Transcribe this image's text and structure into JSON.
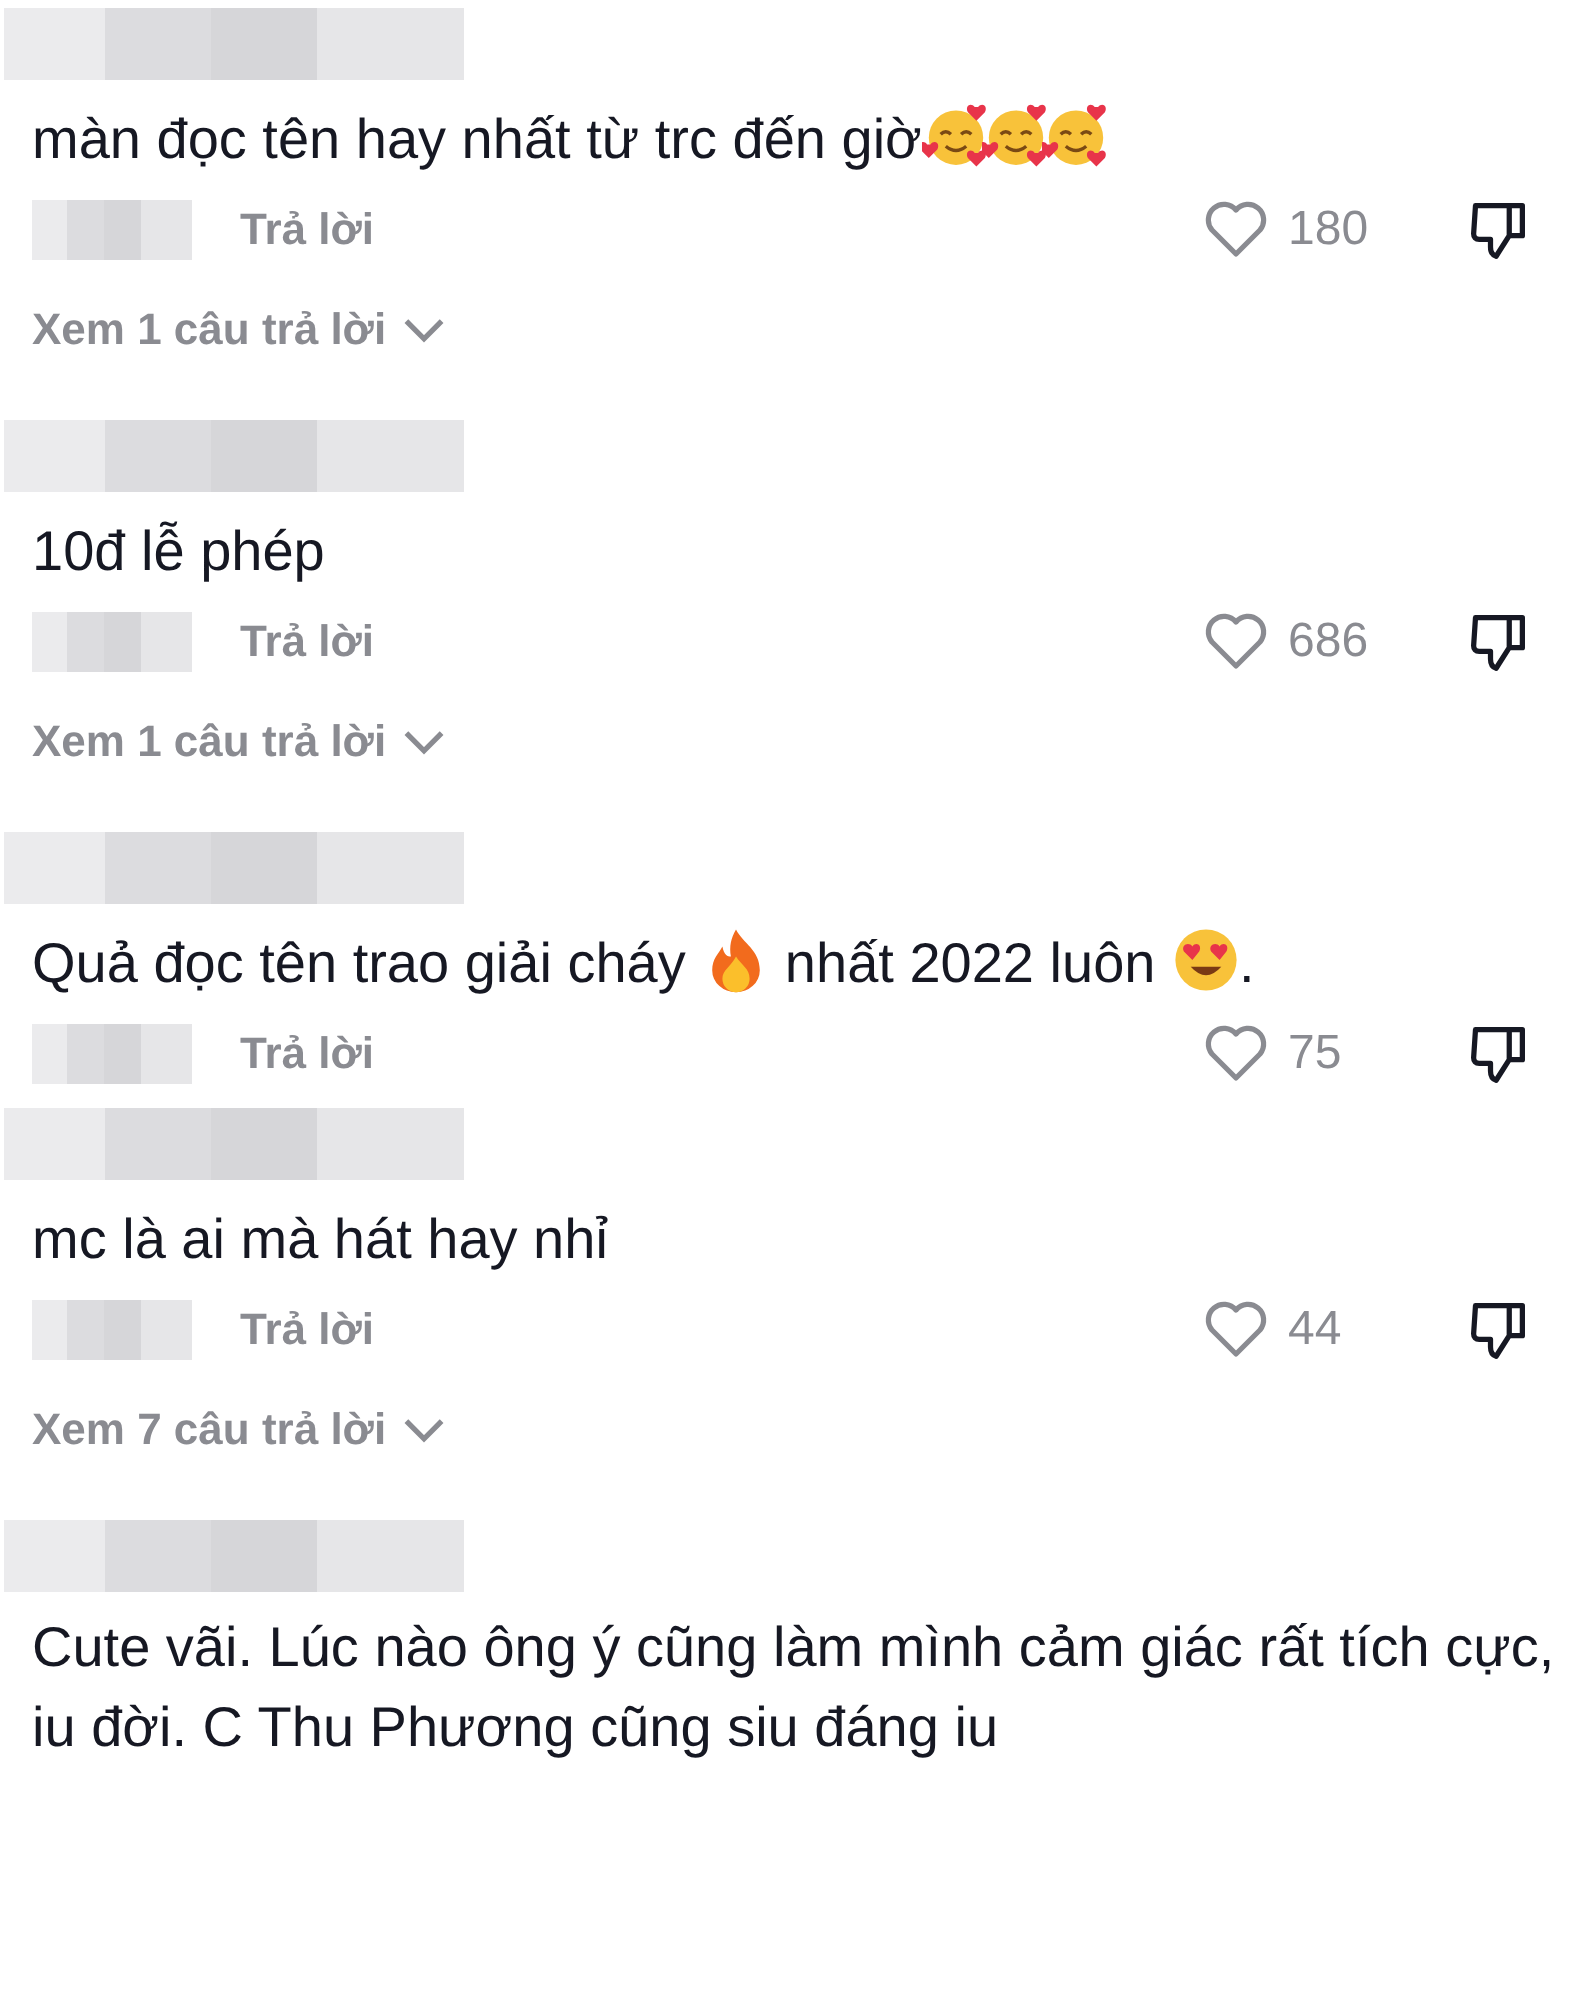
{
  "comments": [
    {
      "parts": [
        {
          "kind": "text",
          "text": "màn đọc tên hay nhất từ trc đến giờ"
        },
        {
          "kind": "smiling-hearts"
        },
        {
          "kind": "smiling-hearts"
        },
        {
          "kind": "smiling-hearts"
        }
      ],
      "reply": "Trả lời",
      "likes": "180",
      "view_replies": "Xem 1 câu trả lời"
    },
    {
      "parts": [
        {
          "kind": "text",
          "text": "10đ lễ phép"
        }
      ],
      "reply": "Trả lời",
      "likes": "686",
      "view_replies": "Xem 1 câu trả lời"
    },
    {
      "parts": [
        {
          "kind": "text",
          "text": "Quả đọc tên trao giải cháy "
        },
        {
          "kind": "fire"
        },
        {
          "kind": "text",
          "text": " nhất 2022 luôn "
        },
        {
          "kind": "heart-eyes"
        },
        {
          "kind": "text",
          "text": "."
        }
      ],
      "reply": "Trả lời",
      "likes": "75"
    },
    {
      "parts": [
        {
          "kind": "text",
          "text": "mc là ai mà hát hay nhỉ"
        }
      ],
      "reply": "Trả lời",
      "likes": "44",
      "view_replies": "Xem 7 câu trả lời"
    },
    {
      "parts": [
        {
          "kind": "text",
          "text": "Cute vãi. Lúc nào ông ý cũng làm mình cảm giác rất tích cực, iu đời. C Thu Phương cũng siu đáng iu"
        }
      ]
    }
  ]
}
